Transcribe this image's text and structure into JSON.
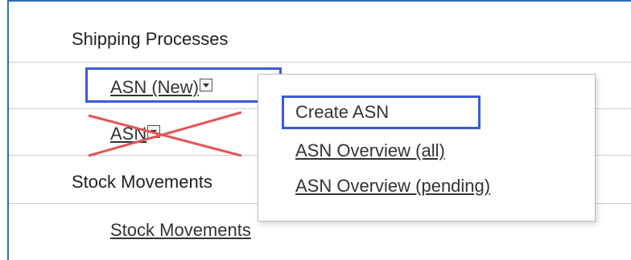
{
  "table": {
    "section_shipping": "Shipping Processes",
    "asn_new": "ASN (New)",
    "asn_old": "ASN",
    "section_stock": "Stock Movements",
    "stock_link": "Stock Movements"
  },
  "dropdown_menu": {
    "items": [
      "Create ASN",
      "ASN Overview (all)",
      "ASN Overview (pending)"
    ]
  },
  "colors": {
    "highlight": "#3b5bdb",
    "cross": "#e25555",
    "frame": "#2b6cb0"
  }
}
